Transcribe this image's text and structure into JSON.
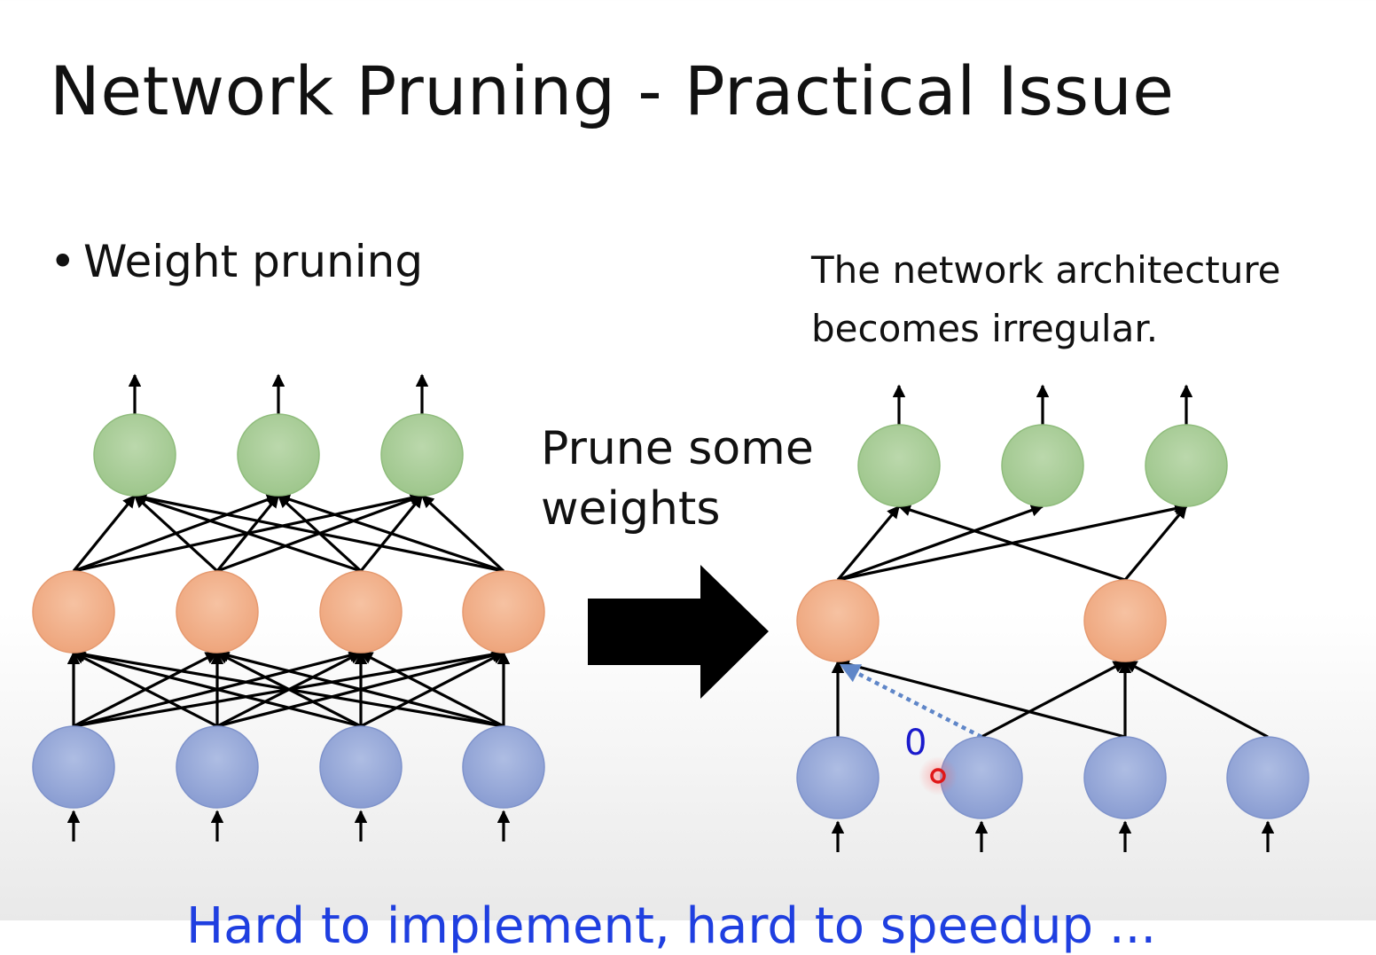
{
  "slide": {
    "title": "Network Pruning - Practical Issue",
    "bullet": {
      "marker": "•",
      "text": "Weight pruning"
    },
    "note": {
      "line1": "The network architecture",
      "line2": "becomes irregular."
    },
    "prune_label": {
      "line1": "Prune some",
      "line2": "weights"
    },
    "zero_weight_label": "0",
    "footer_partial": "Hard to implement, hard to speedup ..."
  },
  "colors": {
    "input_node": "#98a9d8",
    "hidden_node": "#f2b08a",
    "output_node": "#a9cc98",
    "edge": "#000000",
    "pruned_edge": "#5f86c8",
    "footer_text": "#1f3fe0",
    "cursor": "#e01818"
  },
  "diagram": {
    "full_network": {
      "layers": [
        "input",
        "hidden",
        "output"
      ],
      "nodes_per_layer": [
        4,
        4,
        3
      ],
      "input_to_hidden": "all",
      "hidden_to_output": "all"
    },
    "pruned_network": {
      "layers": [
        "input",
        "hidden",
        "output"
      ],
      "nodes_per_layer": [
        4,
        2,
        3
      ],
      "input_to_hidden": [
        [
          0,
          0
        ],
        [
          1,
          1
        ],
        [
          2,
          0
        ],
        [
          2,
          1
        ],
        [
          3,
          1
        ]
      ],
      "hidden_to_output": [
        [
          0,
          0
        ],
        [
          0,
          1
        ],
        [
          0,
          2
        ],
        [
          1,
          0
        ],
        [
          1,
          2
        ]
      ],
      "zeroed_edge": {
        "from_input": 1,
        "to_hidden": 0
      }
    }
  }
}
